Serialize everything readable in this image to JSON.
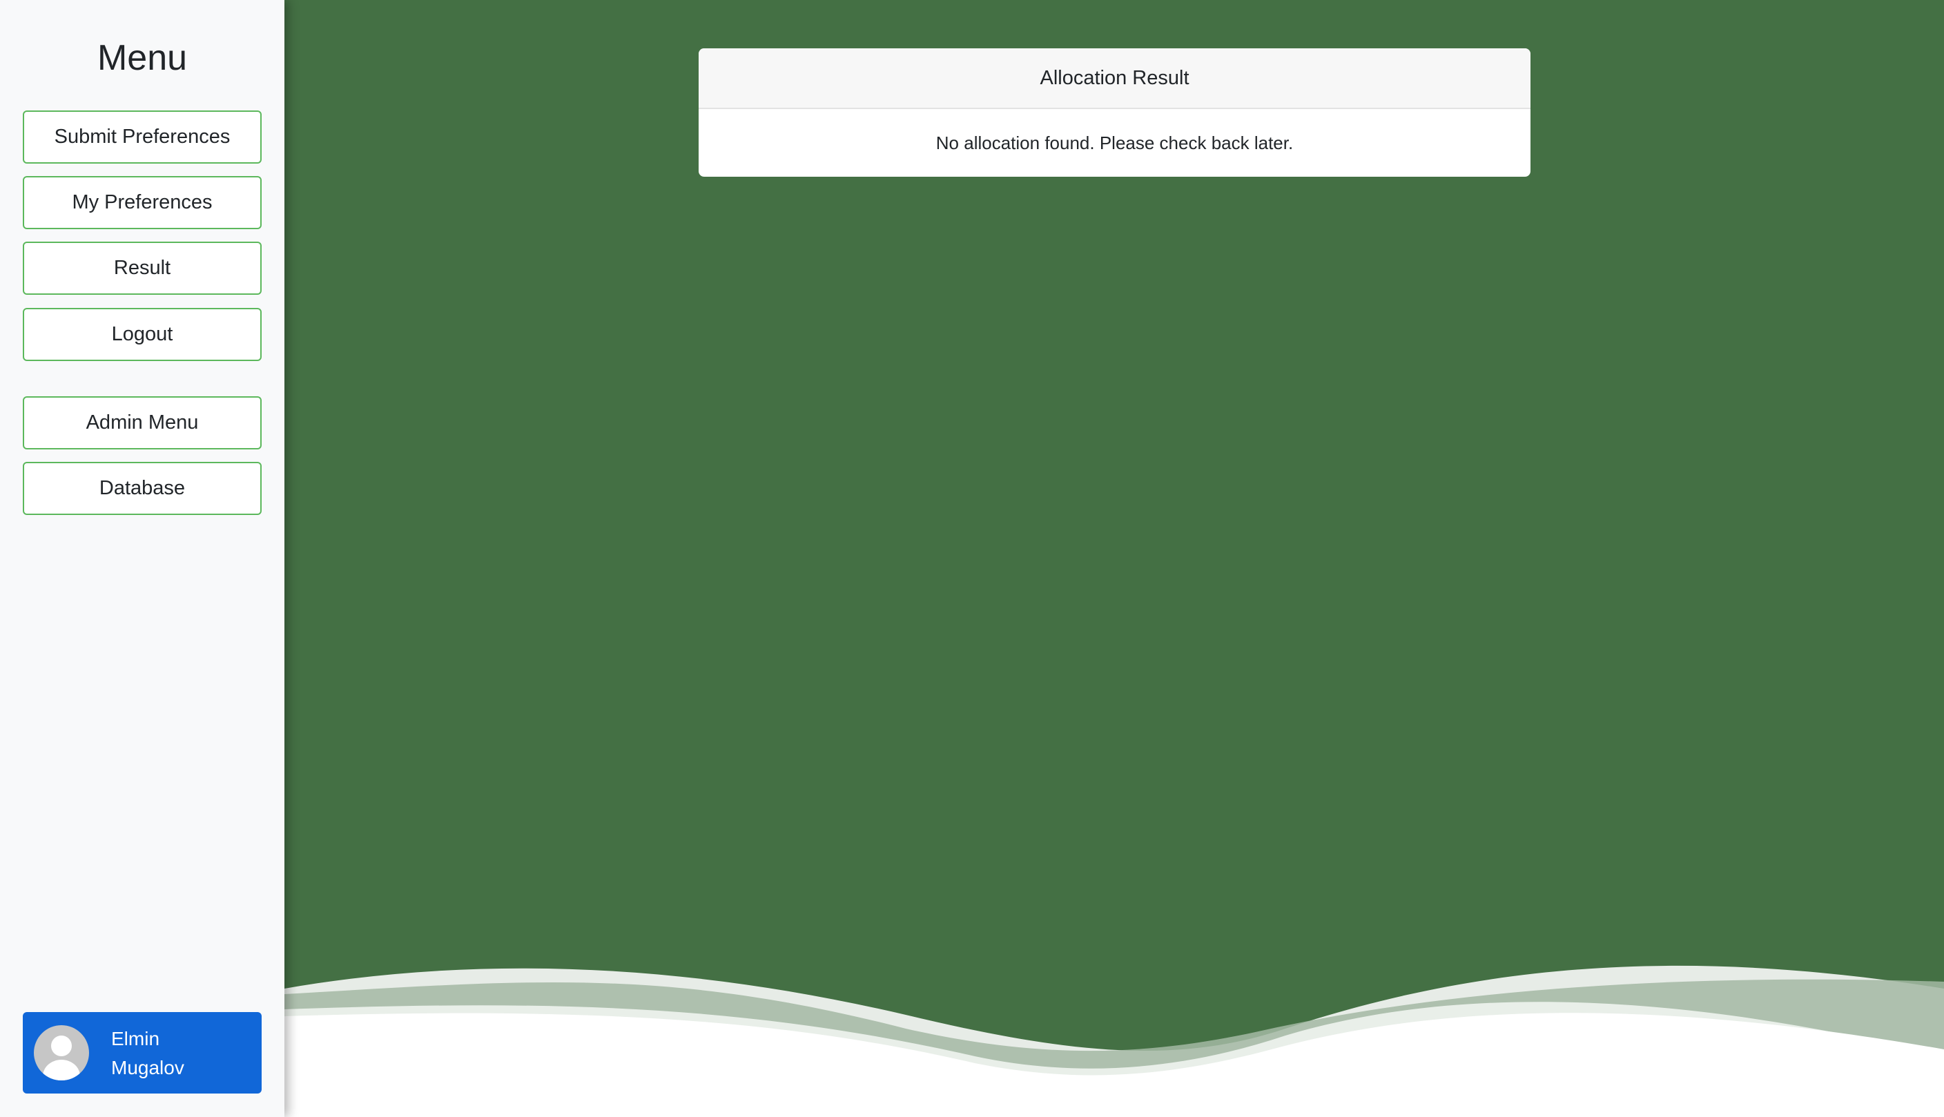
{
  "sidebar": {
    "title": "Menu",
    "items": [
      {
        "label": "Submit Preferences"
      },
      {
        "label": "My Preferences"
      },
      {
        "label": "Result"
      },
      {
        "label": "Logout"
      }
    ],
    "admin_items": [
      {
        "label": "Admin Menu"
      },
      {
        "label": "Database"
      }
    ],
    "user": {
      "first_name": "Elmin",
      "last_name": "Mugalov",
      "avatar_icon": "user-avatar-icon"
    }
  },
  "main": {
    "card": {
      "header": "Allocation Result",
      "body": "No allocation found. Please check back later."
    }
  },
  "colors": {
    "background": "#447044",
    "sidebar_bg": "#f8f9fa",
    "button_border": "#5cb85c",
    "user_card_bg": "#1167d8"
  }
}
